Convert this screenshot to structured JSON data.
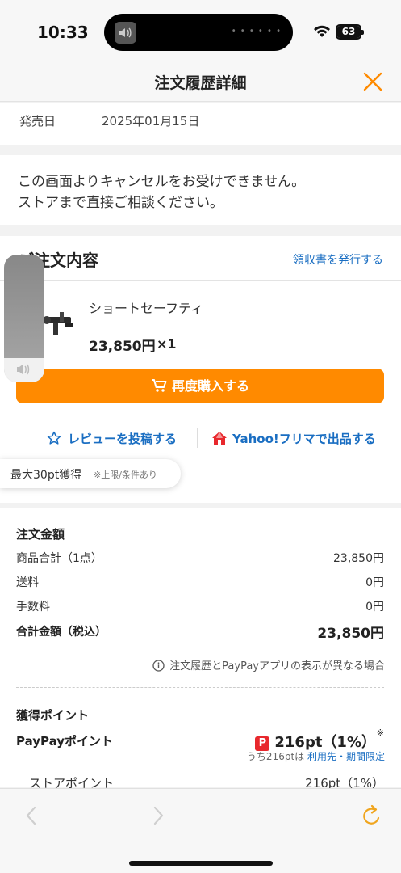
{
  "status": {
    "time": "10:33",
    "battery": "63"
  },
  "header": {
    "title": "注文履歴詳細"
  },
  "release": {
    "label": "発売日",
    "value": "2025年01月15日"
  },
  "notice": {
    "line1": "この画面よりキャンセルをお受けできません。",
    "line2": "ストアまで直接ご相談ください。"
  },
  "order": {
    "title": "ご注文内容",
    "receipt_link": "領収書を発行する",
    "product_name": "ショートセーフティ",
    "price": "23,850円",
    "qty": "×1",
    "rebuy_label": "再度購入する",
    "review_label": "レビューを投稿する",
    "flea_label": "Yahoo!フリマで出品する"
  },
  "tooltip": {
    "main": "最大30pt獲得",
    "sub": "※上限/条件あり"
  },
  "amounts": {
    "title": "注文金額",
    "rows": [
      {
        "label": "商品合計（1点）",
        "value": "23,850円"
      },
      {
        "label": "送料",
        "value": "0円"
      },
      {
        "label": "手数料",
        "value": "0円"
      }
    ],
    "total_label": "合計金額（税込）",
    "total_value": "23,850円",
    "info": "注文履歴とPayPayアプリの表示が異なる場合"
  },
  "points": {
    "title": "獲得ポイント",
    "paypay_label": "PayPayポイント",
    "paypay_value": "216pt（1%）",
    "paypay_mark": "※",
    "note_prefix": "うち216ptは",
    "note_link": "利用先・期間限定",
    "store_label": "ストアポイント",
    "store_value": "216pt（1%）"
  },
  "colors": {
    "accent": "#ff8a00",
    "link": "#1a6ec2",
    "paypay_red": "#e8282d"
  },
  "icons": [
    "close-icon",
    "cart-icon",
    "star-icon",
    "flea-market-icon",
    "info-icon",
    "back-icon",
    "forward-icon",
    "reload-icon",
    "speaker-icon",
    "wifi-icon"
  ]
}
